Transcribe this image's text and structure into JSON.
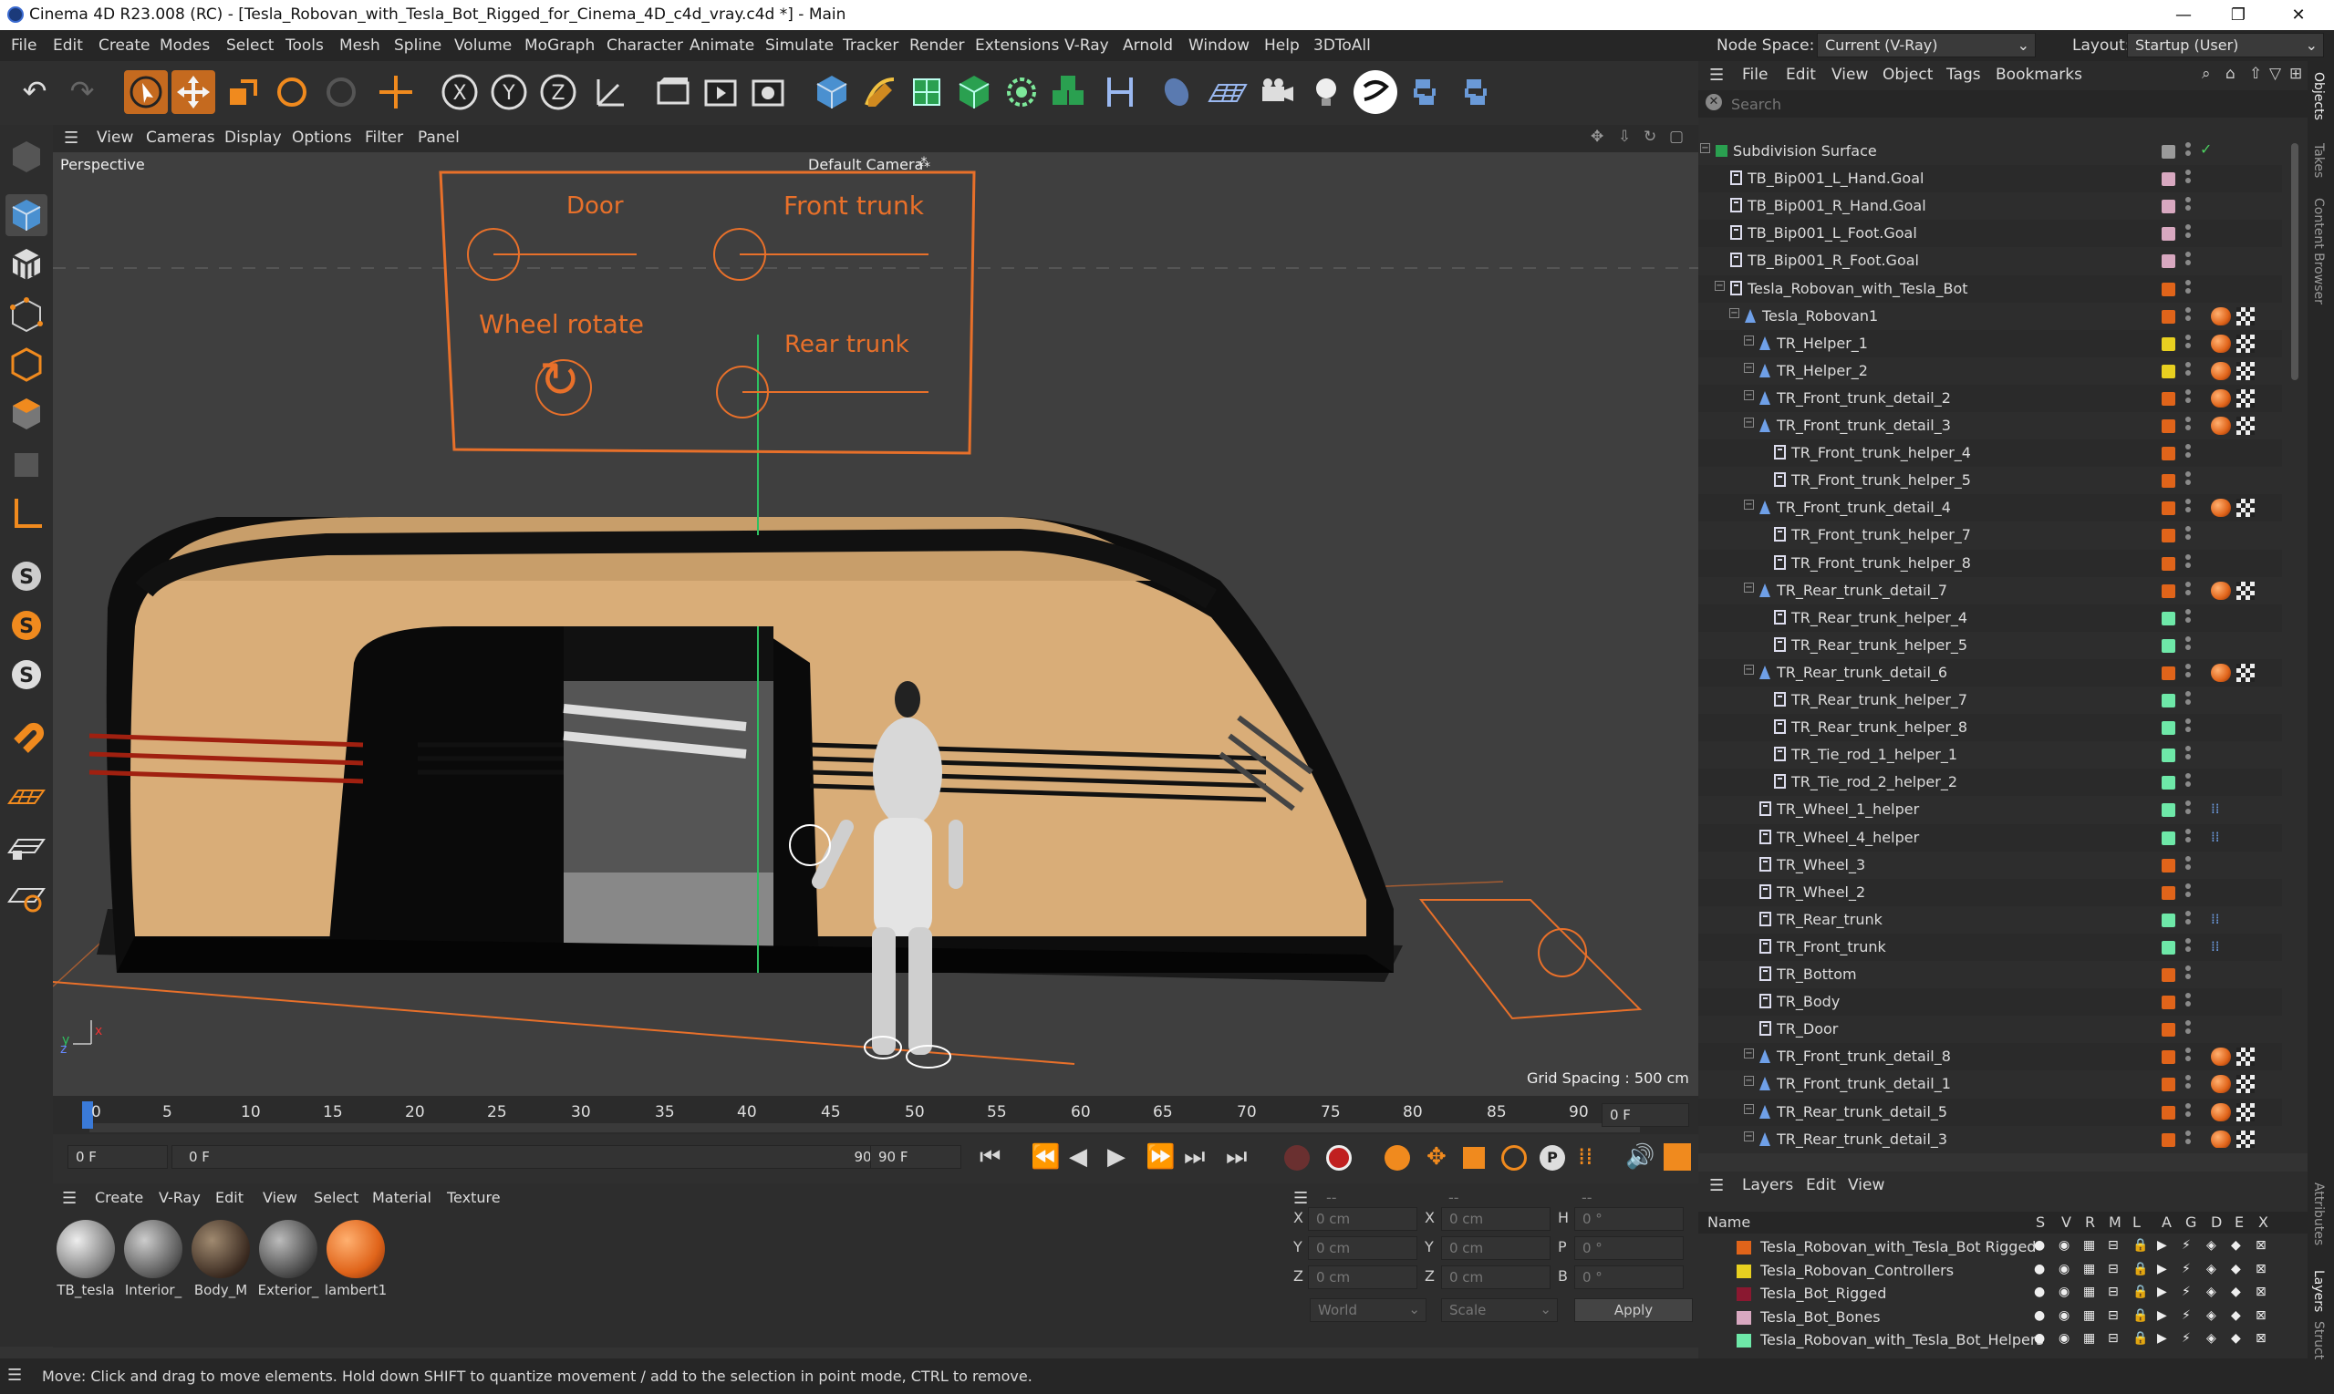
{
  "app": {
    "title": "Cinema 4D R23.008 (RC) - [Tesla_Robovan_with_Tesla_Bot_Rigged_for_Cinema_4D_c4d_vray.c4d *] - Main",
    "window_controls": [
      "—",
      "❐",
      "✕"
    ]
  },
  "menubar": {
    "items": [
      "File",
      "Edit",
      "Create",
      "Modes",
      "Select",
      "Tools",
      "Mesh",
      "Spline",
      "Volume",
      "MoGraph",
      "Character",
      "Animate",
      "Simulate",
      "Tracker",
      "Render",
      "Extensions",
      "V-Ray",
      "Arnold",
      "Window",
      "Help",
      "3DToAll"
    ]
  },
  "nodespace": {
    "label": "Node Space:",
    "value": "Current (V-Ray)",
    "layout_label": "Layout:",
    "layout_value": "Startup (User)"
  },
  "viewport_menu": {
    "items": [
      "View",
      "Cameras",
      "Display",
      "Options",
      "Filter",
      "Panel"
    ]
  },
  "viewport": {
    "mode": "Perspective",
    "camera": "Default Camera",
    "grid_spacing": "Grid Spacing : 500 cm",
    "controls_labels": {
      "door": "Door",
      "front_trunk": "Front trunk",
      "wheel_rotate": "Wheel rotate",
      "rear_trunk": "Rear trunk"
    },
    "accent": "#e8702a"
  },
  "timeline": {
    "ticks": [
      "0",
      "5",
      "10",
      "15",
      "20",
      "25",
      "30",
      "35",
      "40",
      "45",
      "50",
      "55",
      "60",
      "65",
      "70",
      "75",
      "80",
      "85",
      "90"
    ],
    "current_frame": "0 F"
  },
  "transport": {
    "start": "0 F",
    "range_start": "0 F",
    "range_end": "90 F",
    "end": "90 F"
  },
  "material_manager": {
    "menu": [
      "Create",
      "V-Ray",
      "Edit",
      "View",
      "Select",
      "Material",
      "Texture"
    ],
    "materials": [
      {
        "name": "TB_tesla",
        "color": "#bfbfbf"
      },
      {
        "name": "Interior_",
        "color": "#8a8a8a"
      },
      {
        "name": "Body_M",
        "color": "#4a3a30"
      },
      {
        "name": "Exterior_",
        "color": "#6a6a6a"
      },
      {
        "name": "lambert1",
        "color": "#e0641a"
      }
    ]
  },
  "coords": {
    "header": "--",
    "rows": [
      {
        "a": "X",
        "av": "0 cm",
        "b": "X",
        "bv": "0 cm",
        "c": "H",
        "cv": "0 °"
      },
      {
        "a": "Y",
        "av": "0 cm",
        "b": "Y",
        "bv": "0 cm",
        "c": "P",
        "cv": "0 °"
      },
      {
        "a": "Z",
        "av": "0 cm",
        "b": "Z",
        "bv": "0 cm",
        "c": "B",
        "cv": "0 °"
      }
    ],
    "world": "World",
    "scale": "Scale",
    "apply": "Apply"
  },
  "status": {
    "text": "Move: Click and drag to move elements. Hold down SHIFT to quantize movement / add to the selection in point mode, CTRL to remove."
  },
  "object_manager": {
    "menu": [
      "File",
      "Edit",
      "View",
      "Object",
      "Tags",
      "Bookmarks"
    ],
    "search_placeholder": "Search",
    "objects": [
      {
        "name": "Subdivision Surface",
        "indent": 0,
        "color": "#9a9a9a",
        "icon": "subdivision-icon"
      },
      {
        "name": "TB_Bip001_L_Hand.Goal",
        "indent": 1,
        "color": "#d8a8c0",
        "icon": "null-icon"
      },
      {
        "name": "TB_Bip001_R_Hand.Goal",
        "indent": 1,
        "color": "#d8a8c0",
        "icon": "null-icon"
      },
      {
        "name": "TB_Bip001_L_Foot.Goal",
        "indent": 1,
        "color": "#d8a8c0",
        "icon": "null-icon"
      },
      {
        "name": "TB_Bip001_R_Foot.Goal",
        "indent": 1,
        "color": "#d8a8c0",
        "icon": "null-icon"
      },
      {
        "name": "Tesla_Robovan_with_Tesla_Bot",
        "indent": 1,
        "color": "#e0641a",
        "icon": "null-icon"
      },
      {
        "name": "Tesla_Robovan1",
        "indent": 2,
        "color": "#e0641a",
        "icon": "joint-icon"
      },
      {
        "name": "TR_Helper_1",
        "indent": 3,
        "color": "#e8d020",
        "icon": "joint-icon"
      },
      {
        "name": "TR_Helper_2",
        "indent": 3,
        "color": "#e8d020",
        "icon": "joint-icon"
      },
      {
        "name": "TR_Front_trunk_detail_2",
        "indent": 3,
        "color": "#e0641a",
        "icon": "joint-icon"
      },
      {
        "name": "TR_Front_trunk_detail_3",
        "indent": 3,
        "color": "#e0641a",
        "icon": "joint-icon"
      },
      {
        "name": "TR_Front_trunk_helper_4",
        "indent": 4,
        "color": "#e0641a",
        "icon": "null-icon"
      },
      {
        "name": "TR_Front_trunk_helper_5",
        "indent": 4,
        "color": "#e0641a",
        "icon": "null-icon"
      },
      {
        "name": "TR_Front_trunk_detail_4",
        "indent": 3,
        "color": "#e0641a",
        "icon": "joint-icon"
      },
      {
        "name": "TR_Front_trunk_helper_7",
        "indent": 4,
        "color": "#e0641a",
        "icon": "null-icon"
      },
      {
        "name": "TR_Front_trunk_helper_8",
        "indent": 4,
        "color": "#e0641a",
        "icon": "null-icon"
      },
      {
        "name": "TR_Rear_trunk_detail_7",
        "indent": 3,
        "color": "#e0641a",
        "icon": "joint-icon"
      },
      {
        "name": "TR_Rear_trunk_helper_4",
        "indent": 4,
        "color": "#6ee8a8",
        "icon": "null-icon"
      },
      {
        "name": "TR_Rear_trunk_helper_5",
        "indent": 4,
        "color": "#6ee8a8",
        "icon": "null-icon"
      },
      {
        "name": "TR_Rear_trunk_detail_6",
        "indent": 3,
        "color": "#e0641a",
        "icon": "joint-icon"
      },
      {
        "name": "TR_Rear_trunk_helper_7",
        "indent": 4,
        "color": "#6ee8a8",
        "icon": "null-icon"
      },
      {
        "name": "TR_Rear_trunk_helper_8",
        "indent": 4,
        "color": "#6ee8a8",
        "icon": "null-icon"
      },
      {
        "name": "TR_Tie_rod_1_helper_1",
        "indent": 4,
        "color": "#6ee8a8",
        "icon": "null-icon"
      },
      {
        "name": "TR_Tie_rod_2_helper_2",
        "indent": 4,
        "color": "#6ee8a8",
        "icon": "null-icon"
      },
      {
        "name": "TR_Wheel_1_helper",
        "indent": 3,
        "color": "#6ee8a8",
        "icon": "null-icon"
      },
      {
        "name": "TR_Wheel_4_helper",
        "indent": 3,
        "color": "#6ee8a8",
        "icon": "null-icon"
      },
      {
        "name": "TR_Wheel_3",
        "indent": 3,
        "color": "#e0641a",
        "icon": "null-icon"
      },
      {
        "name": "TR_Wheel_2",
        "indent": 3,
        "color": "#e0641a",
        "icon": "null-icon"
      },
      {
        "name": "TR_Rear_trunk",
        "indent": 3,
        "color": "#6ee8a8",
        "icon": "null-icon"
      },
      {
        "name": "TR_Front_trunk",
        "indent": 3,
        "color": "#6ee8a8",
        "icon": "null-icon"
      },
      {
        "name": "TR_Bottom",
        "indent": 3,
        "color": "#e0641a",
        "icon": "null-icon"
      },
      {
        "name": "TR_Body",
        "indent": 3,
        "color": "#e0641a",
        "icon": "null-icon"
      },
      {
        "name": "TR_Door",
        "indent": 3,
        "color": "#e0641a",
        "icon": "null-icon"
      },
      {
        "name": "TR_Front_trunk_detail_8",
        "indent": 3,
        "color": "#e0641a",
        "icon": "joint-icon"
      },
      {
        "name": "TR_Front_trunk_detail_1",
        "indent": 3,
        "color": "#e0641a",
        "icon": "joint-icon"
      },
      {
        "name": "TR_Rear_trunk_detail_5",
        "indent": 3,
        "color": "#e0641a",
        "icon": "joint-icon"
      },
      {
        "name": "TR_Rear_trunk_detail_3",
        "indent": 3,
        "color": "#e0641a",
        "icon": "joint-icon"
      }
    ]
  },
  "layer_manager": {
    "menu": [
      "Layers",
      "Edit",
      "View"
    ],
    "name_header": "Name",
    "flag_headers": [
      "S",
      "V",
      "R",
      "M",
      "L",
      "A",
      "G",
      "D",
      "E",
      "X"
    ],
    "layers": [
      {
        "name": "Tesla_Robovan_with_Tesla_Bot Rigged",
        "color": "#e0641a"
      },
      {
        "name": "Tesla_Robovan_Controllers",
        "color": "#e8d020"
      },
      {
        "name": "Tesla_Bot_Rigged",
        "color": "#8a1830"
      },
      {
        "name": "Tesla_Bot_Bones",
        "color": "#d8a8c0"
      },
      {
        "name": "Tesla_Robovan_with_Tesla_Bot_Helpers",
        "color": "#6ee8a8"
      }
    ]
  },
  "right_tabs": [
    "Objects",
    "Takes",
    "Content Browser",
    "Attributes",
    "Layers",
    "Struct"
  ]
}
